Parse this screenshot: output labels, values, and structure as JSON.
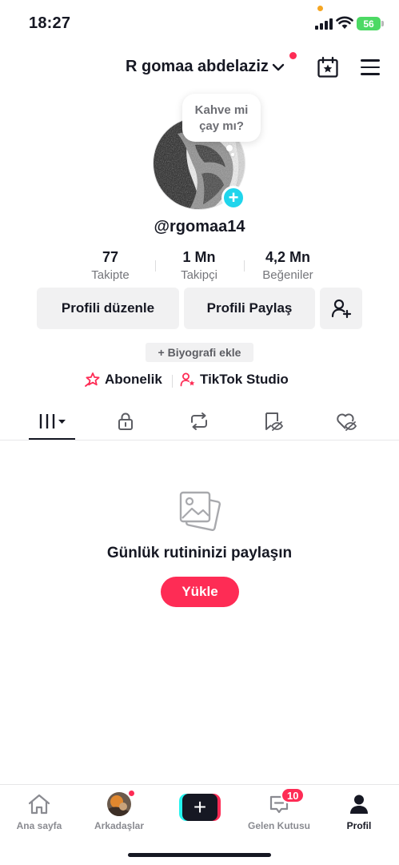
{
  "status_bar": {
    "time": "18:27",
    "battery": "56"
  },
  "header": {
    "username": "R gomaa abdelaziz"
  },
  "profile": {
    "bubble_line1": "Kahve mi",
    "bubble_line2": "çay mı?",
    "handle": "@rgomaa14",
    "stats": [
      {
        "value": "77",
        "label": "Takipte"
      },
      {
        "value": "1 Mn",
        "label": "Takipçi"
      },
      {
        "value": "4,2 Mn",
        "label": "Beğeniler"
      }
    ],
    "edit_label": "Profili düzenle",
    "share_label": "Profili Paylaş",
    "bio_label": "+ Biyografi ekle",
    "subscription_label": "Abonelik",
    "studio_label": "TikTok Studio"
  },
  "tabs": [
    "videos-grid-icon",
    "lock-icon",
    "repost-icon",
    "saved-icon",
    "liked-icon"
  ],
  "empty_state": {
    "title": "Günlük rutininizi paylaşın",
    "upload_label": "Yükle"
  },
  "bottom_nav": {
    "home": "Ana sayfa",
    "friends": "Arkadaşlar",
    "inbox": "Gelen Kutusu",
    "inbox_badge": "10",
    "profile": "Profil"
  },
  "colors": {
    "accent": "#fe2c55",
    "cyan": "#20d5ec",
    "text": "#161823",
    "muted": "#75767b"
  }
}
